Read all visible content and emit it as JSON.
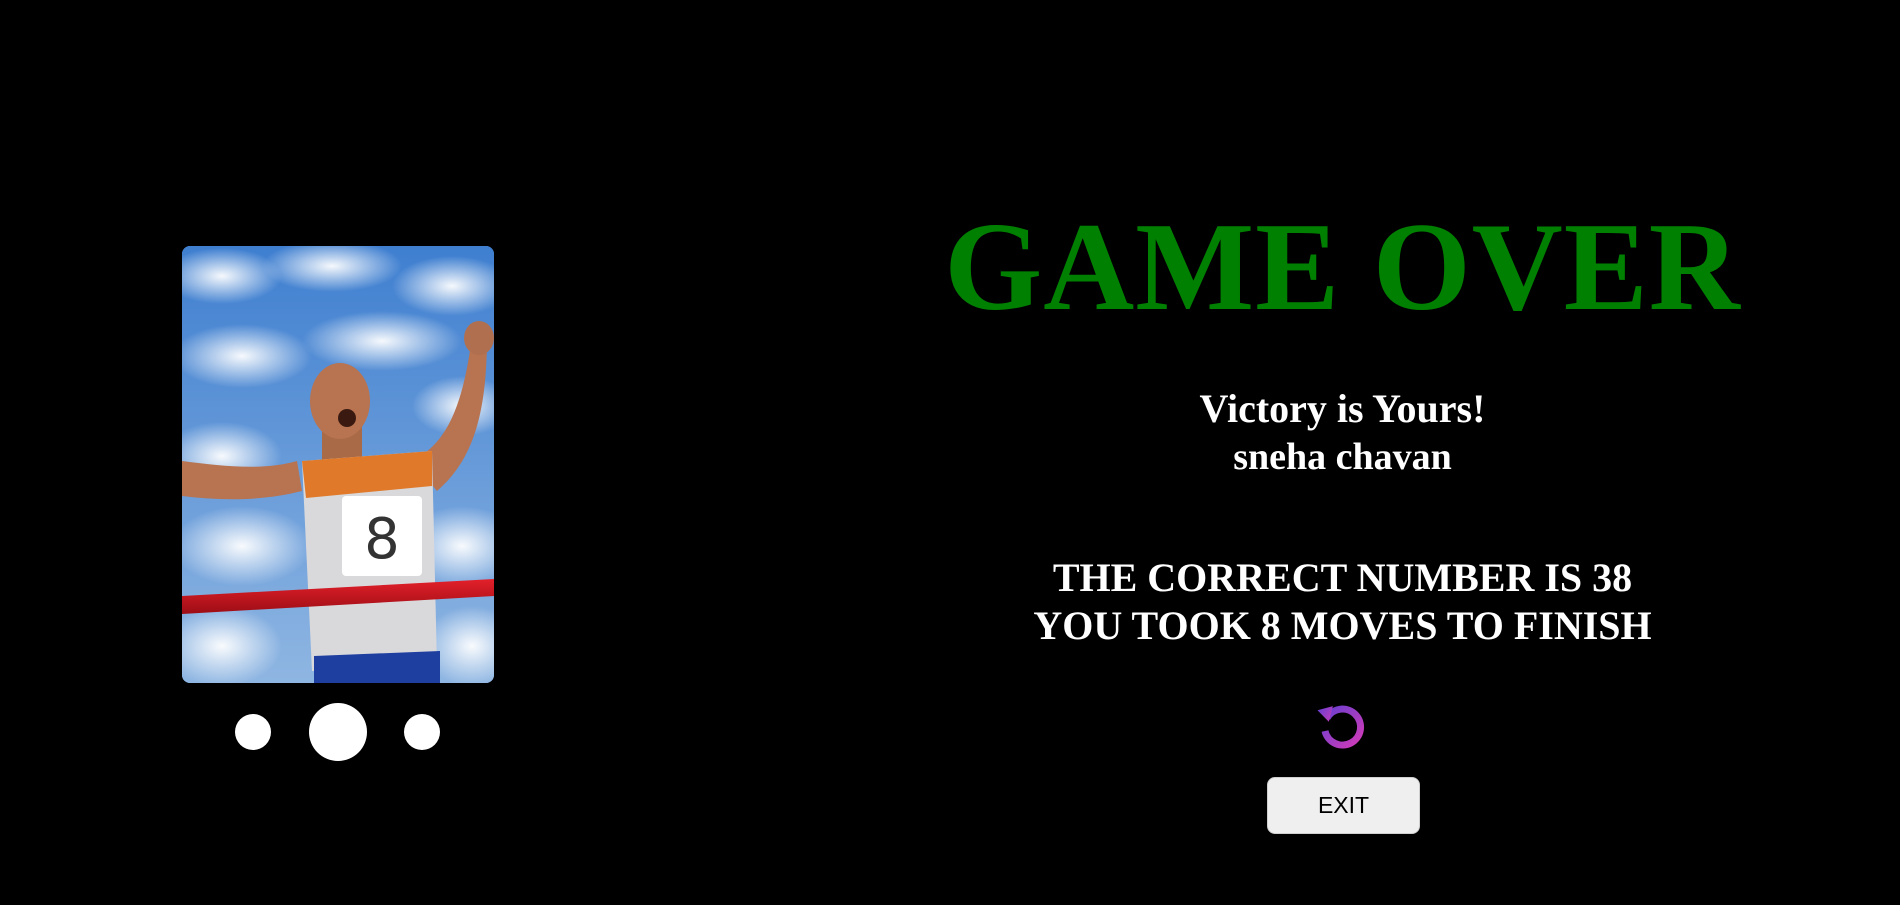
{
  "image": {
    "description_icon": "runner-finish-line-photo-icon",
    "bib_number": "8"
  },
  "carousel": {
    "dots": [
      "dot",
      "dot-active",
      "dot"
    ],
    "active_index": 1
  },
  "result": {
    "title": "GAME OVER",
    "title_color": "#008000",
    "victory_text": "Victory is Yours!",
    "player_name": "sneha chavan",
    "answer_text": "THE CORRECT NUMBER IS 38",
    "moves_text": "YOU TOOK 8 MOVES TO FINISH",
    "restart_icon": "restart-icon",
    "restart_colors": [
      "#6a3fd0",
      "#d13bb8"
    ],
    "exit_label": "EXIT"
  },
  "colors": {
    "background": "#000000",
    "text": "#ffffff",
    "button_bg": "#efefef"
  }
}
